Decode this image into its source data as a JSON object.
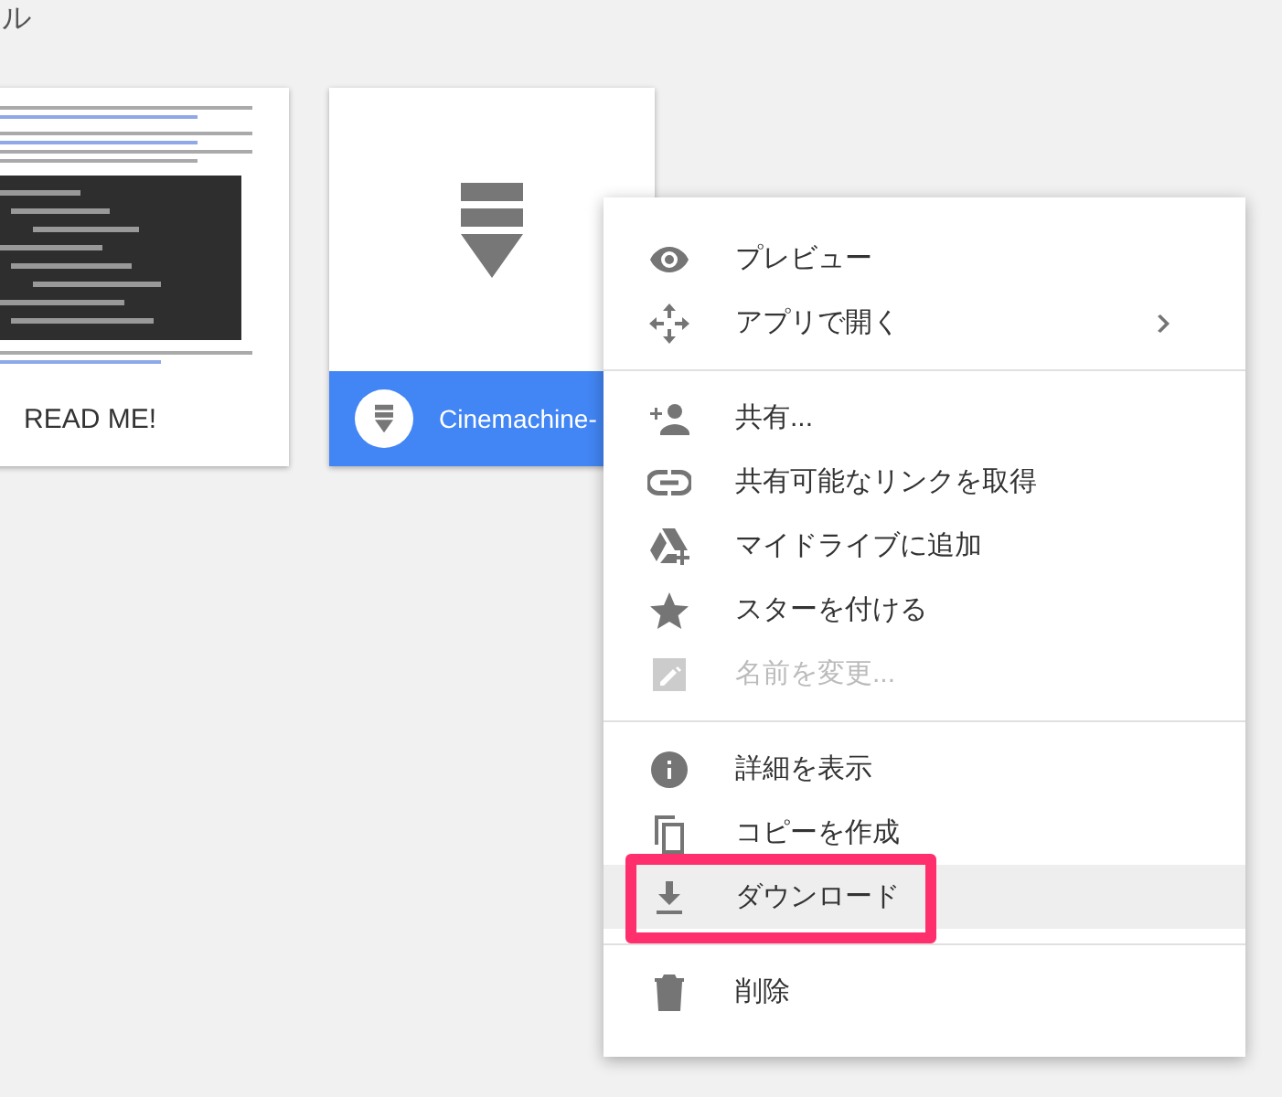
{
  "header": {
    "title": "ル"
  },
  "files": [
    {
      "name": "READ ME!",
      "kind": "document",
      "selected": false
    },
    {
      "name": "Cinemachine-",
      "kind": "package",
      "selected": true
    }
  ],
  "menu": {
    "sections": [
      [
        {
          "label": "プレビュー",
          "disabled": false,
          "has_submenu": false,
          "selected": false
        },
        {
          "label": "アプリで開く",
          "disabled": false,
          "has_submenu": true,
          "selected": false
        }
      ],
      [
        {
          "label": "共有...",
          "disabled": false,
          "has_submenu": false,
          "selected": false
        },
        {
          "label": "共有可能なリンクを取得",
          "disabled": false,
          "has_submenu": false,
          "selected": false
        },
        {
          "label": "マイドライブに追加",
          "disabled": false,
          "has_submenu": false,
          "selected": false
        },
        {
          "label": "スターを付ける",
          "disabled": false,
          "has_submenu": false,
          "selected": false
        },
        {
          "label": "名前を変更...",
          "disabled": true,
          "has_submenu": false,
          "selected": false
        }
      ],
      [
        {
          "label": "詳細を表示",
          "disabled": false,
          "has_submenu": false,
          "selected": false
        },
        {
          "label": "コピーを作成",
          "disabled": false,
          "has_submenu": false,
          "selected": false
        },
        {
          "label": "ダウンロード",
          "disabled": false,
          "has_submenu": false,
          "selected": true
        }
      ],
      [
        {
          "label": "削除",
          "disabled": false,
          "has_submenu": false,
          "selected": false
        }
      ]
    ]
  }
}
